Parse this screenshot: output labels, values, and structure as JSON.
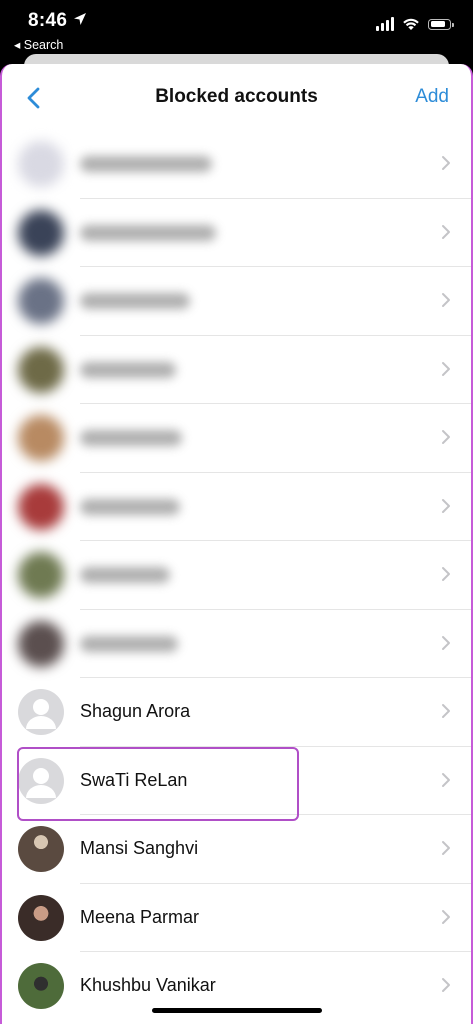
{
  "status": {
    "time": "8:46",
    "back_label": "◂ Search"
  },
  "nav": {
    "title": "Blocked accounts",
    "add_label": "Add"
  },
  "blurred_accounts": [
    {
      "name": "",
      "avatar_color": "#d9d9e3"
    },
    {
      "name": "",
      "avatar_color": "#3a4358"
    },
    {
      "name": "",
      "avatar_color": "#6a7286"
    },
    {
      "name": "",
      "avatar_color": "#6e6a47"
    },
    {
      "name": "",
      "avatar_color": "#b88a62"
    },
    {
      "name": "",
      "avatar_color": "#a83b3b"
    },
    {
      "name": "",
      "avatar_color": "#6f7a52"
    },
    {
      "name": "",
      "avatar_color": "#5b4f4f"
    }
  ],
  "accounts": [
    {
      "name": "Shagun Arora",
      "avatar": "default-avatar"
    },
    {
      "name": "SwaTi ReLan",
      "avatar": "default-avatar"
    },
    {
      "name": "Mansi Sanghvi",
      "avatar": "photo",
      "avatar_color": "#5a4a40"
    },
    {
      "name": "Meena Parmar",
      "avatar": "photo",
      "avatar_color": "#3a2c28"
    },
    {
      "name": "Khushbu Vanikar",
      "avatar": "photo",
      "avatar_color": "#4e6b3a"
    }
  ],
  "colors": {
    "accent": "#2d8cd8",
    "highlight": "#b04fc7"
  }
}
